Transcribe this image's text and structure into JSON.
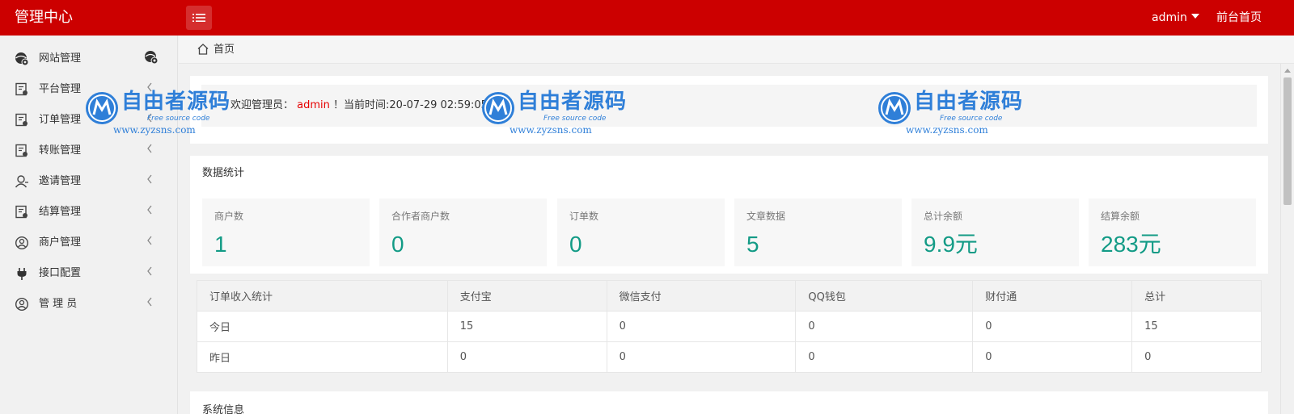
{
  "header": {
    "brand": "管理中心",
    "user": "admin",
    "front_link": "前台首页",
    "bg_color": "#cc0000"
  },
  "sidebar": {
    "items": [
      {
        "label": "网站管理",
        "icon": "globe-icon"
      },
      {
        "label": "平台管理",
        "icon": "document-icon"
      },
      {
        "label": "订单管理",
        "icon": "document-icon"
      },
      {
        "label": "转账管理",
        "icon": "document-icon"
      },
      {
        "label": "邀请管理",
        "icon": "user-icon"
      },
      {
        "label": "结算管理",
        "icon": "document-icon"
      },
      {
        "label": "商户管理",
        "icon": "user-circle-icon"
      },
      {
        "label": "接口配置",
        "icon": "plug-icon"
      },
      {
        "label": "管 理 员",
        "icon": "user-circle-icon"
      }
    ]
  },
  "breadcrumb": {
    "label": "首页"
  },
  "welcome": {
    "prefix": "欢迎管理员：",
    "username": "admin",
    "suffix": "！当前时间:20-07-29 02:59:05"
  },
  "stats": {
    "title": "数据统计",
    "value_color": "#139b86",
    "items": [
      {
        "label": "商户数",
        "value": "1"
      },
      {
        "label": "合作者商户数",
        "value": "0"
      },
      {
        "label": "订单数",
        "value": "0"
      },
      {
        "label": "文章数据",
        "value": "5"
      },
      {
        "label": "总计余额",
        "value": "9.9元"
      },
      {
        "label": "结算余额",
        "value": "283元"
      }
    ]
  },
  "income_table": {
    "headers": [
      "订单收入统计",
      "支付宝",
      "微信支付",
      "QQ钱包",
      "财付通",
      "总计"
    ],
    "rows": [
      [
        "今日",
        "15",
        "0",
        "0",
        "0",
        "15"
      ],
      [
        "昨日",
        "0",
        "0",
        "0",
        "0",
        "0"
      ]
    ]
  },
  "system_info": {
    "title": "系统信息"
  },
  "watermark": {
    "main": "自由者源码",
    "sub": "Free source code",
    "url": "www.zyzsns.com",
    "color": "#2f7fd8"
  }
}
